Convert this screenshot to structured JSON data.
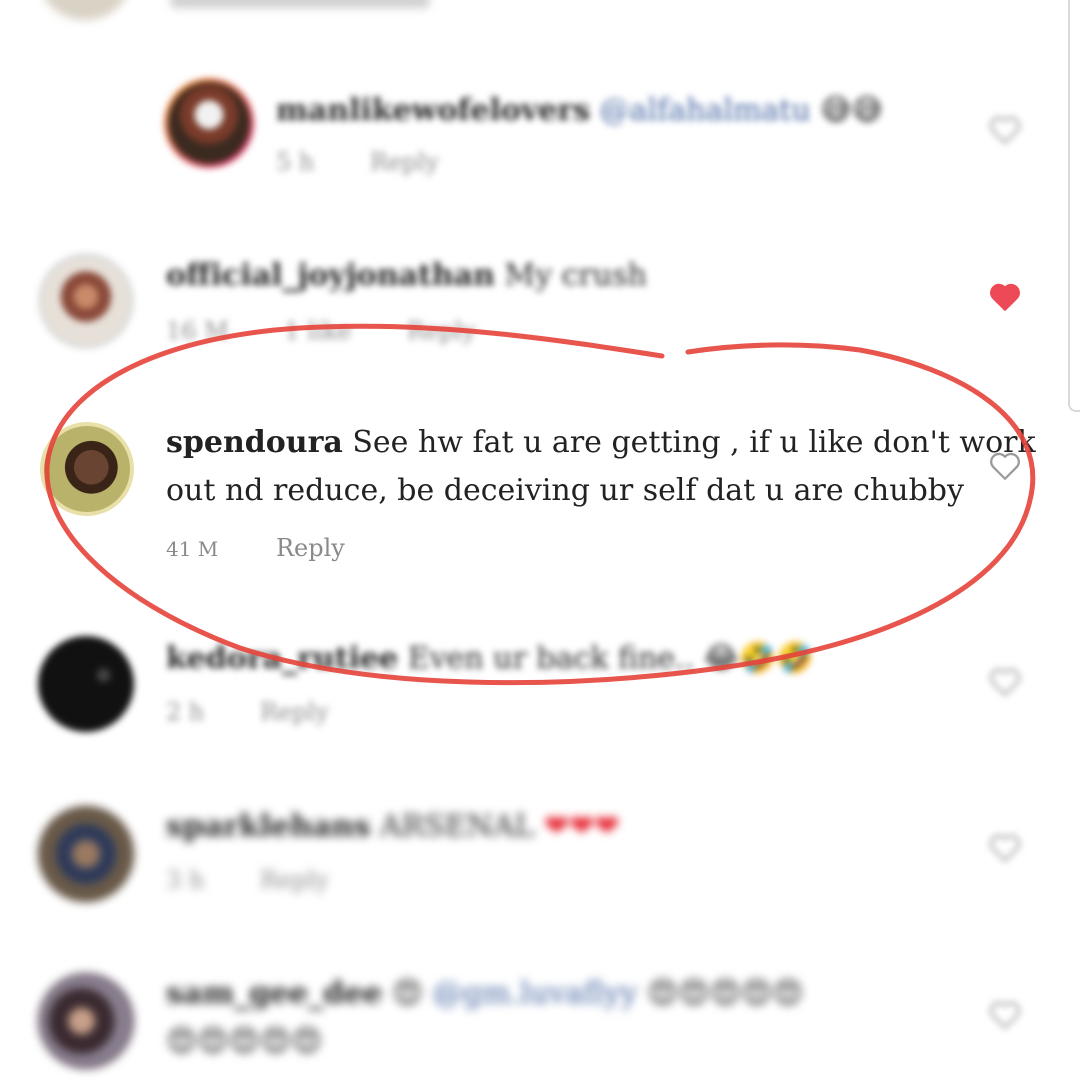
{
  "comments": [
    {
      "username": "manlikewofelovers",
      "text": "@alfahalmatu",
      "emoji": "😅😅",
      "time": "5 h",
      "reply": "Reply",
      "liked": false
    },
    {
      "username": "official_joyjonathan",
      "text": "My crush",
      "time": "16 M",
      "likes": "1 like",
      "reply": "Reply",
      "liked": true
    },
    {
      "username": "spendoura",
      "text_line1": "See hw fat u are getting , if u like don't work",
      "text_line2": "out nd reduce, be deceiving ur self dat  u are chubby",
      "time": "41 M",
      "reply": "Reply",
      "liked": false
    },
    {
      "username": "kedora_rutiee",
      "text": "Even ur back fine..",
      "emoji": "😂🤣🤣",
      "time": "2 h",
      "reply": "Reply",
      "liked": false
    },
    {
      "username": "sparklehans",
      "text": "ARSENAL",
      "emoji": "❤❤❤",
      "time": "3 h",
      "reply": "Reply",
      "liked": false
    },
    {
      "username": "sam_gee_dee",
      "text": "@gm.luvaflyy",
      "emoji_line1": "😍",
      "emoji_line2": "😍😍😍😍😍",
      "emoji_line3": "😍😍😍😍😍",
      "liked": false
    }
  ],
  "colors": {
    "annotation_circle": "#e4433a",
    "heart_liked": "#ed4956",
    "heart_outline": "#9a9a9a",
    "meta_gray": "#8a8a8a",
    "mention_blue": "#3d5f9e"
  },
  "icons": {
    "like": "heart-icon",
    "liked": "heart-filled-icon"
  }
}
